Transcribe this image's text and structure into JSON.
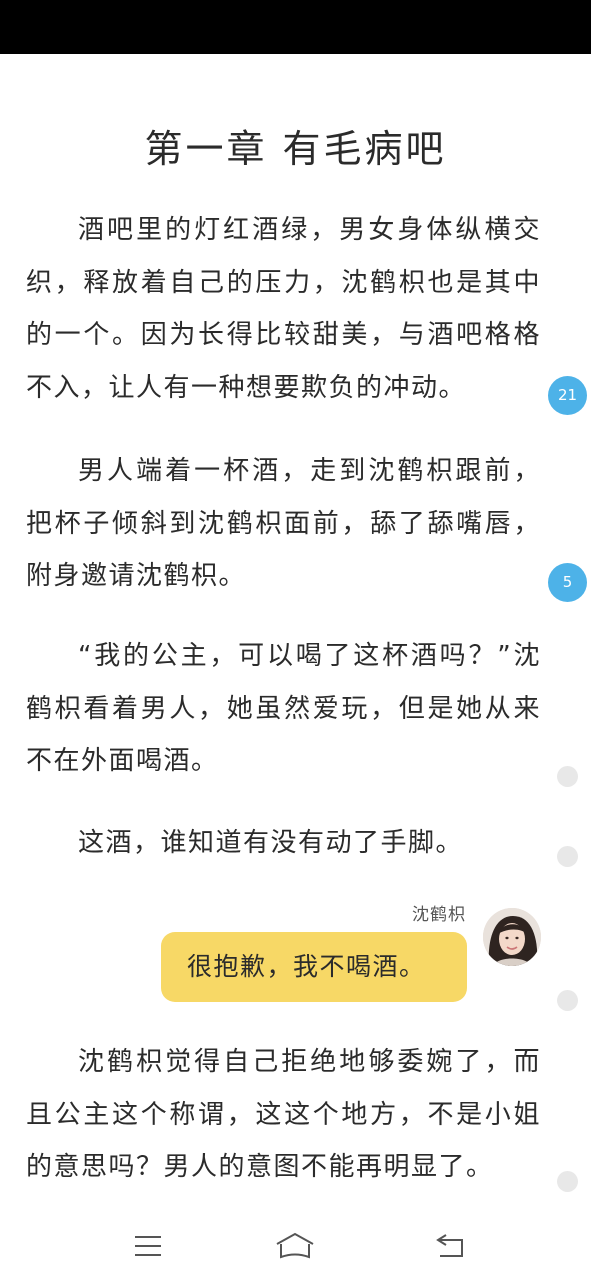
{
  "chapter": {
    "title": "第一章 有毛病吧"
  },
  "paragraphs": [
    "酒吧里的灯红酒绿，男女身体纵横交织，释放着自己的压力，沈鹤枳也是其中的一个。因为长得比较甜美，与酒吧格格不入，让人有一种想要欺负的冲动。",
    "男人端着一杯酒，走到沈鹤枳跟前，把杯子倾斜到沈鹤枳面前，舔了舔嘴唇，附身邀请沈鹤枳。",
    "“我的公主，可以喝了这杯酒吗？”沈鹤枳看着男人，她虽然爱玩，但是她从来不在外面喝酒。",
    "这酒，谁知道有没有动了手脚。",
    "沈鹤枳觉得自己拒绝地够委婉了，而且公主这个称谓，这这个地方，不是小姐的意思吗？男人的意图不能再明显了。"
  ],
  "chat": {
    "speaker": "沈鹤枳",
    "message": "很抱歉，我不喝酒。"
  },
  "comments": {
    "badge_1": "21",
    "badge_2": "5",
    "badge_color": "#4db2e8"
  },
  "bubble_color": "#f7d866",
  "nav": {
    "menu_icon": "menu-icon",
    "home_icon": "home-icon",
    "back_icon": "back-icon"
  }
}
